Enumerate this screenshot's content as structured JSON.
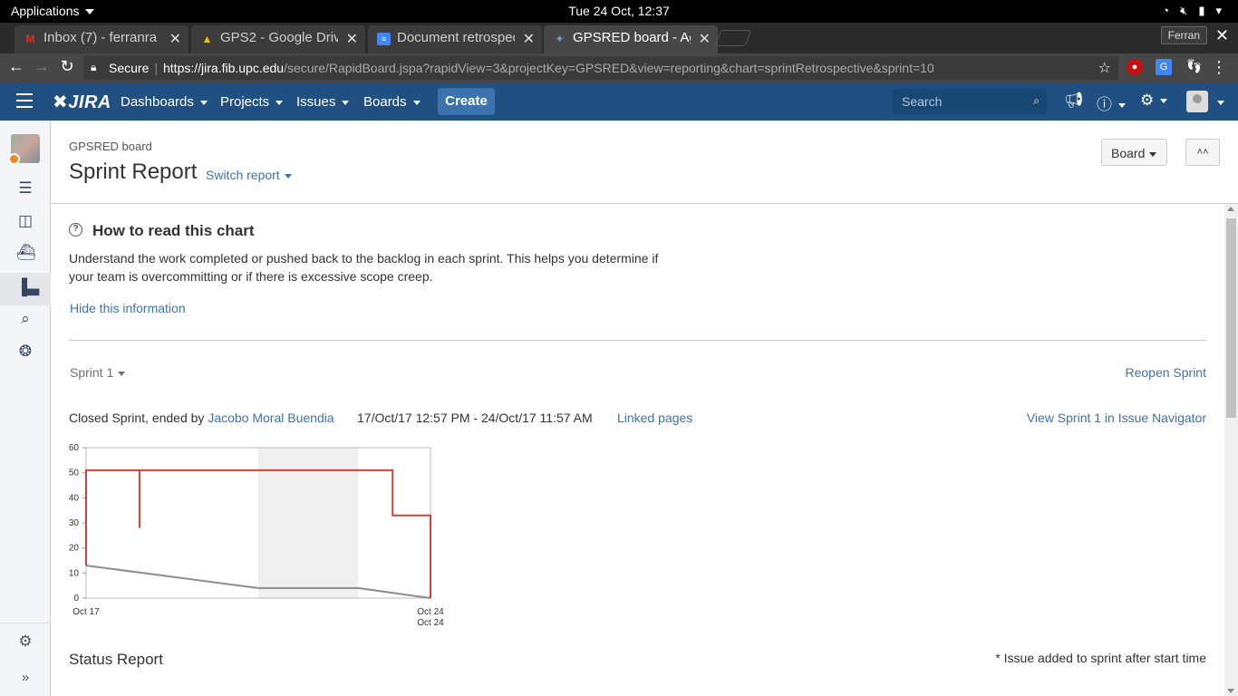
{
  "os": {
    "applications": "Applications",
    "clock": "Tue 24 Oct, 12:37"
  },
  "browser": {
    "tabs": [
      {
        "title": "Inbox (7) - ferranra",
        "icon": "gmail-icon"
      },
      {
        "title": "GPS2 - Google Driv",
        "icon": "drive-icon"
      },
      {
        "title": "Document retrospec",
        "icon": "docs-icon"
      },
      {
        "title": "GPSRED board - Ag",
        "icon": "jira-icon"
      }
    ],
    "profile": "Ferran",
    "secure_label": "Secure",
    "url_host": "https://jira.fib.upc.edu",
    "url_path": "/secure/RapidBoard.jspa?rapidView=3&projectKey=GPSRED&view=reporting&chart=sprintRetrospective&sprint=10"
  },
  "jira": {
    "logo": "JIRA",
    "nav": {
      "dashboards": "Dashboards",
      "projects": "Projects",
      "issues": "Issues",
      "boards": "Boards"
    },
    "create": "Create",
    "search_placeholder": "Search"
  },
  "page": {
    "board_name": "GPSRED board",
    "title": "Sprint Report",
    "switch_report": "Switch report",
    "board_button": "Board",
    "help": {
      "title": "How to read this chart",
      "text": "Understand the work completed or pushed back to the backlog in each sprint. This helps you determine if your team is overcommitting or if there is excessive scope creep.",
      "hide": "Hide this information"
    },
    "sprint_select": "Sprint 1",
    "reopen": "Reopen Sprint",
    "sprint_status": "Closed Sprint, ended by ",
    "ended_by": "Jacobo Moral Buendia",
    "dates": "17/Oct/17 12:57 PM - 24/Oct/17 11:57 AM",
    "linked_pages": "Linked pages",
    "view_in_navigator": "View Sprint 1 in Issue Navigator",
    "status_report": "Status Report",
    "issue_note": "* Issue added to sprint after start time"
  },
  "chart_data": {
    "type": "line",
    "y_ticks": [
      "0",
      "10",
      "20",
      "30",
      "40",
      "50",
      "60"
    ],
    "ylim": [
      0,
      60
    ],
    "x_labels": {
      "start": "Oct 17",
      "end": "Oct 24",
      "end2": "Oct 24"
    },
    "non_working_band": [
      0.5,
      0.79
    ],
    "series": [
      {
        "color": "#d04437",
        "points": [
          [
            0,
            13
          ],
          [
            0,
            51
          ],
          [
            0.155,
            51
          ],
          [
            0.155,
            28
          ],
          [
            0.155,
            51
          ],
          [
            0.89,
            51
          ],
          [
            0.89,
            33
          ],
          [
            1.0,
            33
          ],
          [
            1.0,
            0
          ]
        ]
      },
      {
        "color": "#8c8c8c",
        "points": [
          [
            0,
            13
          ],
          [
            0.5,
            4
          ],
          [
            0.79,
            4
          ],
          [
            1.0,
            0
          ]
        ]
      }
    ]
  }
}
